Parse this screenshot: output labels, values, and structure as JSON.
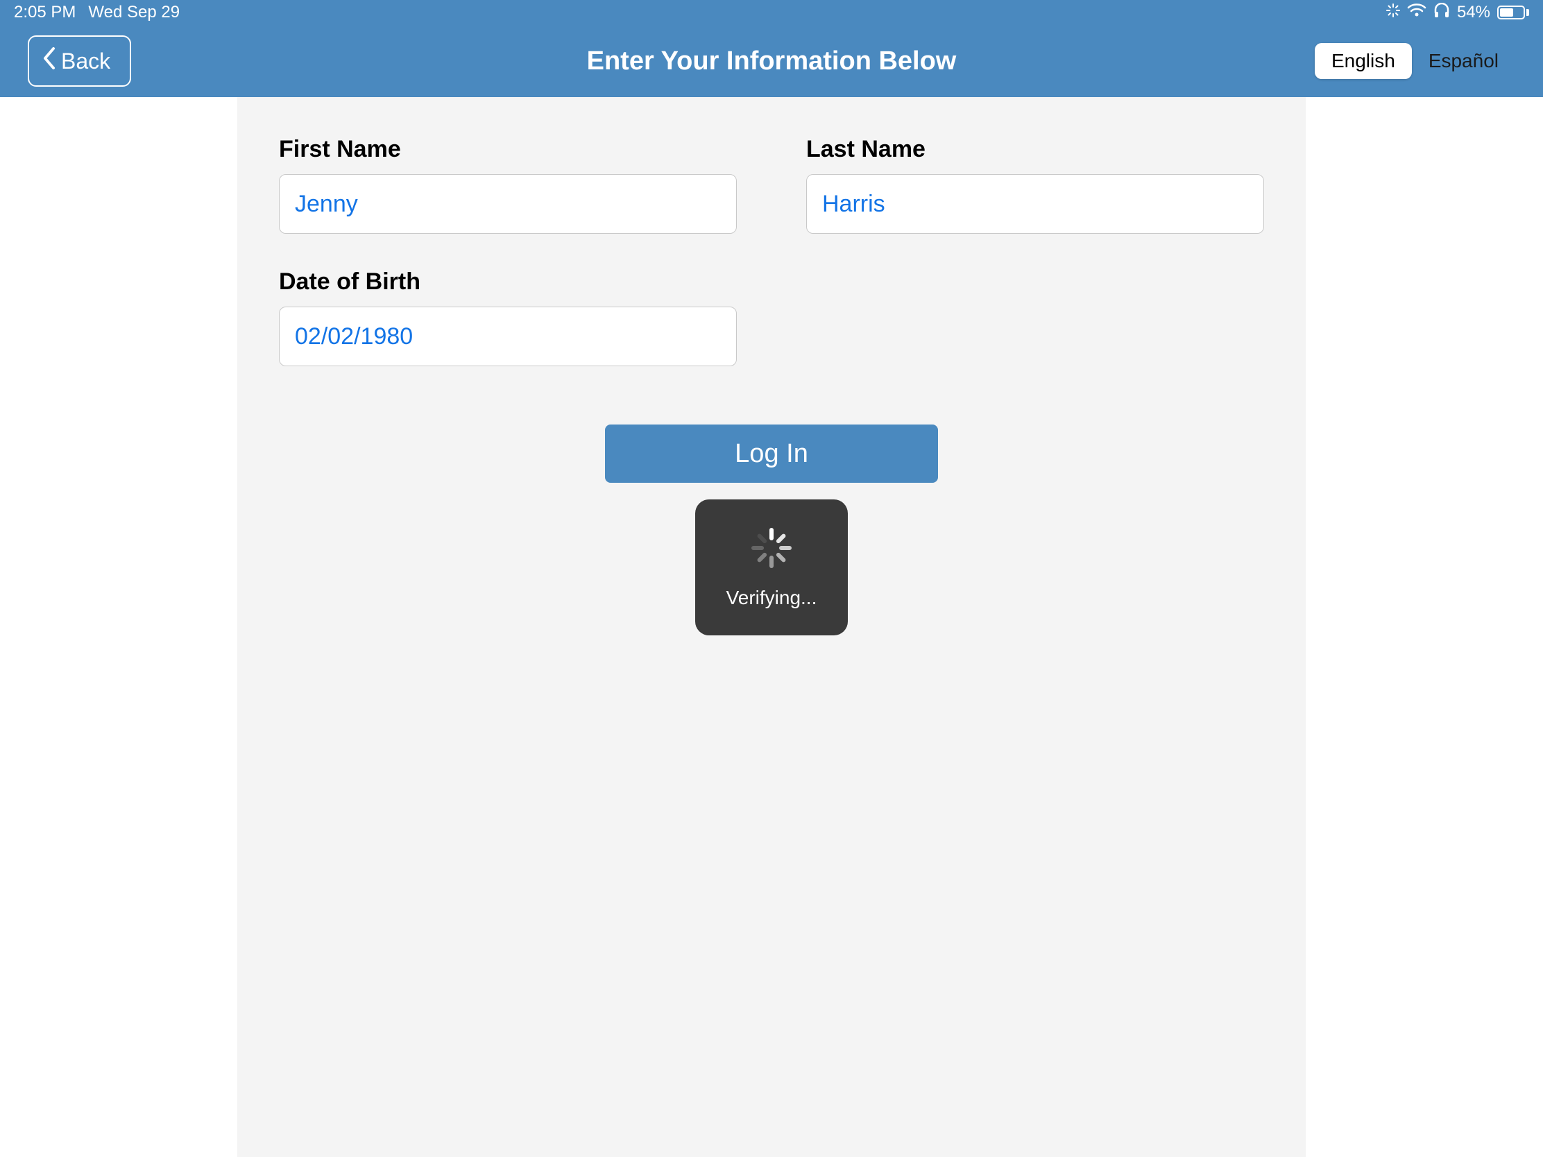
{
  "status": {
    "time": "2:05 PM",
    "date": "Wed Sep 29",
    "battery_pct": "54%"
  },
  "header": {
    "back_label": "Back",
    "title": "Enter Your Information Below",
    "lang_english": "English",
    "lang_spanish": "Español"
  },
  "form": {
    "first_name_label": "First Name",
    "first_name_value": "Jenny",
    "last_name_label": "Last Name",
    "last_name_value": "Harris",
    "dob_label": "Date of Birth",
    "dob_value": "02/02/1980",
    "login_label": "Log In"
  },
  "overlay": {
    "verifying_text": "Verifying..."
  }
}
